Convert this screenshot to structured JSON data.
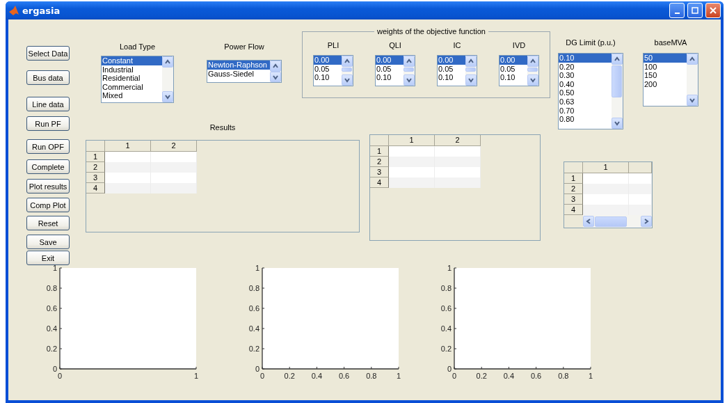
{
  "window": {
    "title": "ergasia"
  },
  "buttons": [
    "Select Data",
    "Bus data",
    "Line data",
    "Run PF",
    "Run OPF",
    "Complete",
    "Plot results",
    "Comp Plot",
    "Reset",
    "Save",
    "Exit"
  ],
  "load_type": {
    "label": "Load Type",
    "items": [
      {
        "label": "Constant",
        "selected": true
      },
      {
        "label": "Industrial",
        "selected": false
      },
      {
        "label": "Residential",
        "selected": false
      },
      {
        "label": "Commercial",
        "selected": false
      },
      {
        "label": "Mixed",
        "selected": false
      }
    ]
  },
  "power_flow": {
    "label": "Power Flow",
    "items": [
      {
        "label": "Newton-Raphson",
        "selected": true
      },
      {
        "label": "Gauss-Siedel",
        "selected": false
      }
    ]
  },
  "weights": {
    "title": "weights of the objective function",
    "lists": [
      {
        "label": "PLI",
        "items": [
          {
            "label": "0.00",
            "selected": true
          },
          {
            "label": "0.05",
            "selected": false
          },
          {
            "label": "0.10",
            "selected": false
          }
        ]
      },
      {
        "label": "QLI",
        "items": [
          {
            "label": "0.00",
            "selected": true
          },
          {
            "label": "0.05",
            "selected": false
          },
          {
            "label": "0.10",
            "selected": false
          }
        ]
      },
      {
        "label": "IC",
        "items": [
          {
            "label": "0.00",
            "selected": true
          },
          {
            "label": "0.05",
            "selected": false
          },
          {
            "label": "0.10",
            "selected": false
          }
        ]
      },
      {
        "label": "IVD",
        "items": [
          {
            "label": "0.00",
            "selected": true
          },
          {
            "label": "0.05",
            "selected": false
          },
          {
            "label": "0.10",
            "selected": false
          }
        ]
      }
    ]
  },
  "dg_limit": {
    "label": "DG Limit (p.u.)",
    "items": [
      {
        "label": "0.10",
        "selected": true
      },
      {
        "label": "0.20",
        "selected": false
      },
      {
        "label": "0.30",
        "selected": false
      },
      {
        "label": "0.40",
        "selected": false
      },
      {
        "label": "0.50",
        "selected": false
      },
      {
        "label": "0.63",
        "selected": false
      },
      {
        "label": "0.70",
        "selected": false
      },
      {
        "label": "0.80",
        "selected": false
      }
    ]
  },
  "base_mva": {
    "label": "baseMVA",
    "items": [
      {
        "label": "50",
        "selected": true
      },
      {
        "label": "100",
        "selected": false
      },
      {
        "label": "150",
        "selected": false
      },
      {
        "label": "200",
        "selected": false
      }
    ]
  },
  "results": {
    "label": "Results",
    "table": {
      "columns": [
        "1",
        "2"
      ],
      "rows": [
        "1",
        "2",
        "3",
        "4"
      ]
    }
  },
  "table_2": {
    "columns": [
      "1",
      "2"
    ],
    "rows": [
      "1",
      "2",
      "3",
      "4"
    ]
  },
  "table_3": {
    "columns": [
      "1"
    ],
    "rows": [
      "1",
      "2",
      "3",
      "4"
    ]
  },
  "charts": [
    {
      "chart_data": {
        "type": "line",
        "xlim": [
          0,
          1
        ],
        "ylim": [
          0,
          1
        ],
        "xticks": [
          0,
          1
        ],
        "yticks": [
          0,
          0.2,
          0.4,
          0.6,
          0.8,
          1
        ]
      }
    },
    {
      "chart_data": {
        "type": "line",
        "xlim": [
          0,
          1
        ],
        "ylim": [
          0,
          1
        ],
        "xticks": [
          0,
          0.2,
          0.4,
          0.6,
          0.8,
          1
        ],
        "yticks": [
          0,
          0.2,
          0.4,
          0.6,
          0.8,
          1
        ]
      }
    },
    {
      "chart_data": {
        "type": "line",
        "xlim": [
          0,
          1
        ],
        "ylim": [
          0,
          1
        ],
        "xticks": [
          0,
          0.2,
          0.4,
          0.6,
          0.8,
          1
        ],
        "yticks": [
          0,
          0.2,
          0.4,
          0.6,
          0.8,
          1
        ]
      }
    }
  ]
}
